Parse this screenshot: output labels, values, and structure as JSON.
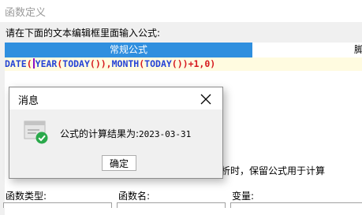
{
  "window": {
    "title": "函数定义"
  },
  "prompt": "请在下面的文本编辑框里面输入公式:",
  "tabs": {
    "active": "常规公式",
    "next_partial": "脚"
  },
  "formula": {
    "t1": "DATE",
    "t2": "(",
    "t3": "YEAR",
    "t4": "(",
    "t5": "TODAY",
    "t6": "()),",
    "t7": "MONTH",
    "t8": "(",
    "t9": "TODAY",
    "t10": "())+1,0)"
  },
  "background": {
    "option_text": "分析时，保留公式用于计算",
    "label_type": "函数类型:",
    "label_name": "函数名:",
    "label_var": "变量:"
  },
  "dialog": {
    "title": "消息",
    "message_prefix": "公式的计算结果为:",
    "message_value": "2023-03-31",
    "ok_label": "确定",
    "icon": "check-success-icon"
  },
  "colors": {
    "tab_active": "#2f8fdf",
    "function_keyword": "#2443d6",
    "formula_text": "#d6191e",
    "formula_line_bg": "#fffbe0",
    "success_green": "#2aa94b"
  }
}
